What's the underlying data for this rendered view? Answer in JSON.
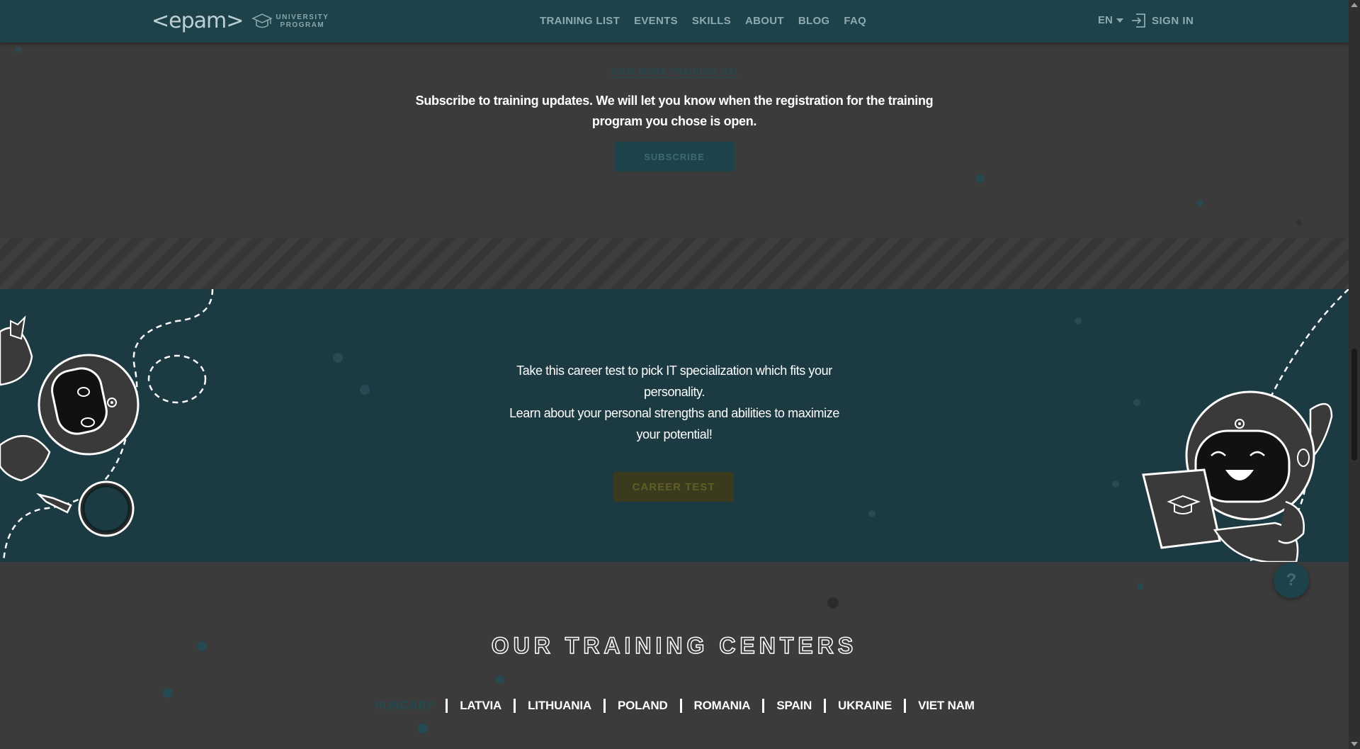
{
  "header": {
    "logo_text": "<epam>",
    "program_line1": "UNIVERSITY",
    "program_line2": "PROGRAM",
    "nav": [
      "TRAINING LIST",
      "EVENTS",
      "SKILLS",
      "ABOUT",
      "BLOG",
      "FAQ"
    ],
    "language": "EN",
    "sign_in": "SIGN IN"
  },
  "subscribe_section": {
    "view_more": "VIEW MORE TRAINING (25)",
    "text": "Subscribe to training updates. We will let you know when the registration for the training program you chose is open.",
    "button": "SUBSCRIBE"
  },
  "career_section": {
    "line1": "Take this career test to pick IT specialization which fits your personality.",
    "line2": "Learn about your personal strengths and abilities to maximize your potential!",
    "button": "CAREER TEST"
  },
  "help_button": "?",
  "centers": {
    "title": "OUR TRAINING CENTERS",
    "countries": [
      "HUNGARY",
      "LATVIA",
      "LITHUANIA",
      "POLAND",
      "ROMANIA",
      "SPAIN",
      "UKRAINE",
      "VIET NAM"
    ],
    "active": "HUNGARY"
  },
  "colors": {
    "header_bg": "#1e4249",
    "page_bg": "#3b3b3b",
    "career_bg": "#1c3a41",
    "accent_teal": "#234a52",
    "career_button": "#3a3a1e"
  }
}
